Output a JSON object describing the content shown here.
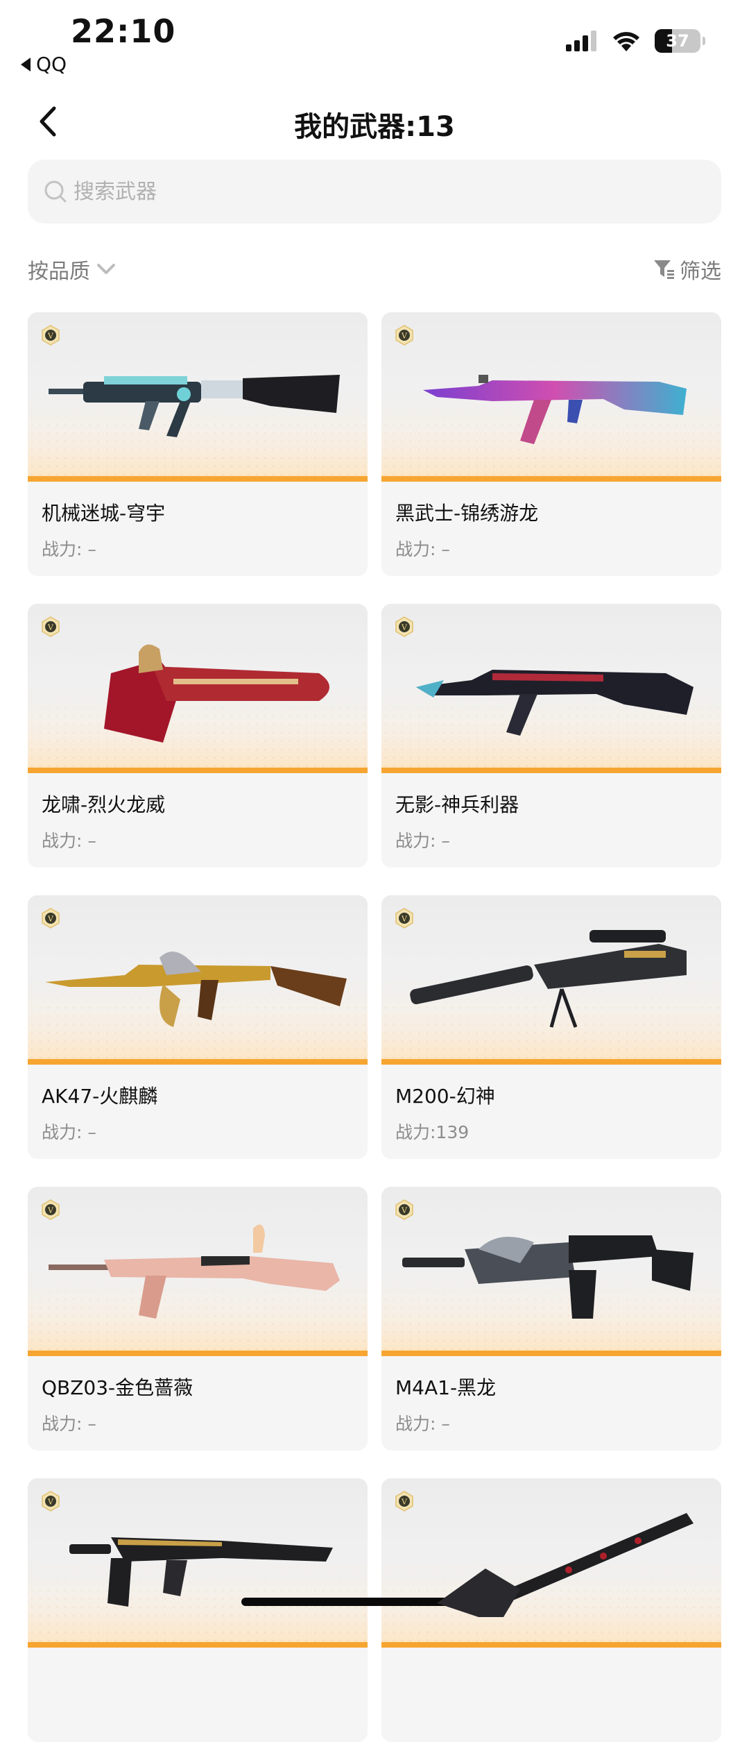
{
  "status_bar": {
    "time": "22:10",
    "back_app": "QQ",
    "battery": "37"
  },
  "header": {
    "title": "我的武器:13"
  },
  "search": {
    "placeholder": "搜索武器"
  },
  "filters": {
    "sort_label": "按品质",
    "filter_label": "筛选"
  },
  "colors": {
    "accent_orange": "#f6a531",
    "badge_gold": "#e8c36a",
    "muted_text": "#8c8c8c"
  },
  "weapons": [
    {
      "name": "机械迷城-穹宇",
      "power": "战力: –",
      "icon": "rifle-icon"
    },
    {
      "name": "黑武士-锦绣游龙",
      "power": "战力: –",
      "icon": "rifle-icon"
    },
    {
      "name": "龙啸-烈火龙威",
      "power": "战力: –",
      "icon": "axe-icon"
    },
    {
      "name": "无影-神兵利器",
      "power": "战力: –",
      "icon": "rifle-icon"
    },
    {
      "name": "AK47-火麒麟",
      "power": "战力: –",
      "icon": "rifle-icon"
    },
    {
      "name": "M200-幻神",
      "power": "战力:139",
      "icon": "sniper-icon"
    },
    {
      "name": "QBZ03-金色蔷薇",
      "power": "战力: –",
      "icon": "rifle-icon"
    },
    {
      "name": "M4A1-黑龙",
      "power": "战力: –",
      "icon": "rifle-icon"
    },
    {
      "name": "",
      "power": "",
      "icon": "smg-icon"
    },
    {
      "name": "",
      "power": "",
      "icon": "shovel-icon"
    }
  ]
}
